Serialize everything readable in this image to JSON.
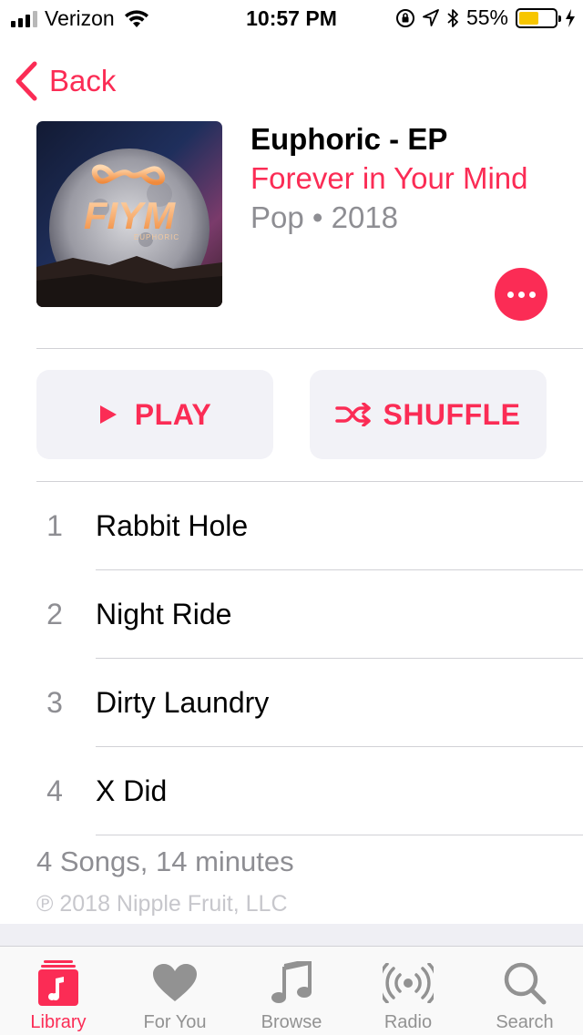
{
  "status_bar": {
    "carrier": "Verizon",
    "time": "10:57 PM",
    "battery_percent": "55%",
    "battery_level": 0.55,
    "battery_color": "#f7c600"
  },
  "nav": {
    "back_label": "Back"
  },
  "album": {
    "title": "Euphoric - EP",
    "artist": "Forever in Your Mind",
    "meta": "Pop • 2018",
    "artwork_logo": "FIYM",
    "artwork_sublabel": "EUPHORIC"
  },
  "actions": {
    "play_label": "PLAY",
    "shuffle_label": "SHUFFLE"
  },
  "tracks": [
    {
      "number": "1",
      "title": "Rabbit Hole"
    },
    {
      "number": "2",
      "title": "Night Ride"
    },
    {
      "number": "3",
      "title": "Dirty Laundry"
    },
    {
      "number": "4",
      "title": "X Did"
    }
  ],
  "footer": {
    "summary": "4 Songs, 14 minutes",
    "copyright": "℗ 2018 Nipple Fruit, LLC"
  },
  "tab_bar": {
    "tabs": [
      {
        "label": "Library",
        "icon": "library-icon",
        "active": true
      },
      {
        "label": "For You",
        "icon": "heart-icon",
        "active": false
      },
      {
        "label": "Browse",
        "icon": "music-note-icon",
        "active": false
      },
      {
        "label": "Radio",
        "icon": "radio-icon",
        "active": false
      },
      {
        "label": "Search",
        "icon": "search-icon",
        "active": false
      }
    ]
  },
  "colors": {
    "accent": "#fb2c55",
    "secondary_text": "#8e8e93",
    "inactive_tab": "#929292"
  }
}
